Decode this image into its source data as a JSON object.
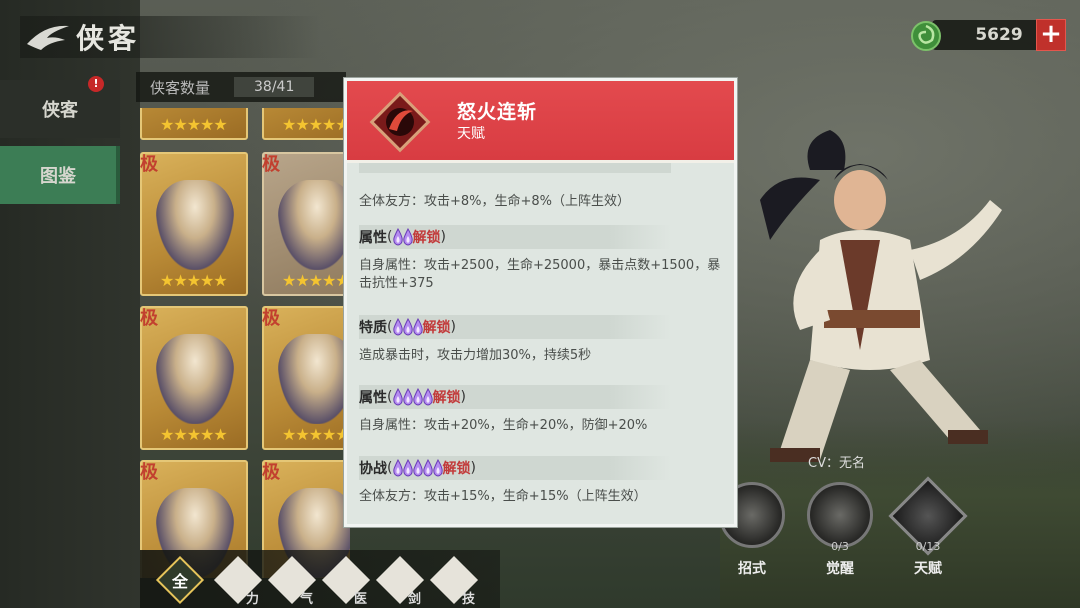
{
  "header": {
    "title": "侠客",
    "currency_value": "5629",
    "add_label": "+"
  },
  "sidebar": {
    "items": [
      {
        "label": "侠客",
        "badge": "!"
      },
      {
        "label": "图鉴"
      }
    ]
  },
  "hero_list": {
    "count_label": "侠客数量",
    "count_value": "38/41",
    "rarity_mark": "极",
    "stars": "★★★★★"
  },
  "filters": [
    {
      "label": "全"
    },
    {
      "label": "力"
    },
    {
      "label": "气"
    },
    {
      "label": "医"
    },
    {
      "label": "剑"
    },
    {
      "label": "技"
    }
  ],
  "hero_panel": {
    "cv_label": "CV：无名",
    "skills": [
      {
        "label": "招式",
        "count": ""
      },
      {
        "label": "觉醒",
        "count": "0/3"
      },
      {
        "label": "天赋",
        "count": "0/13"
      }
    ]
  },
  "popup": {
    "skill_name": "怒火连斩",
    "skill_type": "天赋",
    "sections": [
      {
        "desc": "全体友方：攻击+8%，生命+8%（上阵生效）"
      },
      {
        "title": "属性",
        "flames": 2,
        "paren_open": "(",
        "unlock": "解锁",
        "paren_close": ")",
        "desc": "自身属性：攻击+2500，生命+25000，暴击点数+1500，暴击抗性+375"
      },
      {
        "title": "特质",
        "flames": 3,
        "paren_open": "(",
        "unlock": "解锁",
        "paren_close": ")",
        "desc": "造成暴击时，攻击力增加30%，持续5秒"
      },
      {
        "title": "属性",
        "flames": 4,
        "paren_open": "(",
        "unlock": "解锁",
        "paren_close": ")",
        "desc": "自身属性：攻击+20%，生命+20%，防御+20%"
      },
      {
        "title": "协战",
        "flames": 5,
        "paren_open": "(",
        "unlock": "解锁",
        "paren_close": ")",
        "desc": "全体友方：攻击+15%，生命+15%（上阵生效）"
      }
    ]
  },
  "colors": {
    "popup_header": "#df4347",
    "unlock_text": "#c23a3a",
    "tab_active": "#3c7d55",
    "add_button": "#c0312b"
  }
}
